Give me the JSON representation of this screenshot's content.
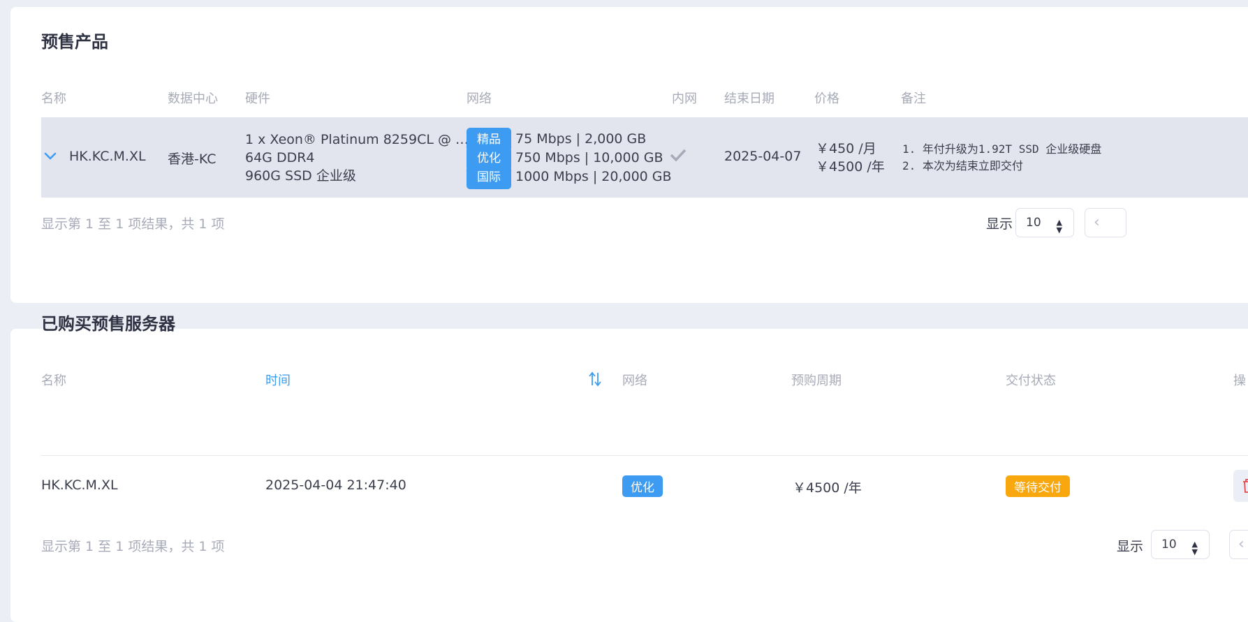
{
  "presale": {
    "title": "预售产品",
    "headers": {
      "name": "名称",
      "datacenter": "数据中心",
      "hardware": "硬件",
      "network": "网络",
      "intranet": "内网",
      "end_date": "结束日期",
      "price": "价格",
      "notes": "备注"
    },
    "row": {
      "name": "HK.KC.M.XL",
      "datacenter": "香港-KC",
      "hardware": [
        "1 x Xeon® Platinum 8259CL @ …",
        "64G DDR4",
        "960G SSD 企业级"
      ],
      "network": [
        {
          "tag": "精品",
          "text": "75 Mbps | 2,000 GB"
        },
        {
          "tag": "优化",
          "text": "750 Mbps | 10,000 GB"
        },
        {
          "tag": "国际",
          "text": "1000 Mbps | 20,000 GB"
        }
      ],
      "end_date": "2025-04-07",
      "price_month": "￥450 /月",
      "price_year": "￥4500 /年",
      "notes": [
        "1. 年付升级为1.92T SSD 企业级硬盘",
        "2. 本次为结束立即交付"
      ]
    },
    "footer": "显示第 1 至 1 项结果，共 1 项",
    "show_label": "显示",
    "page_size": "10"
  },
  "purchased": {
    "title": "已购买预售服务器",
    "headers": {
      "name": "名称",
      "time": "时间",
      "network": "网络",
      "cycle": "预购周期",
      "status": "交付状态",
      "action": "操"
    },
    "row": {
      "name": "HK.KC.M.XL",
      "time": "2025-04-04 21:47:40",
      "network": "优化",
      "cycle": "￥4500 /年",
      "status": "等待交付"
    },
    "footer": "显示第 1 至 1 项结果，共 1 项",
    "show_label": "显示",
    "page_size": "10"
  },
  "colors": {
    "accent": "#3d9cf2",
    "warning": "#f8a80e",
    "row_highlight": "#e2e4ee",
    "background": "#eceef6"
  }
}
